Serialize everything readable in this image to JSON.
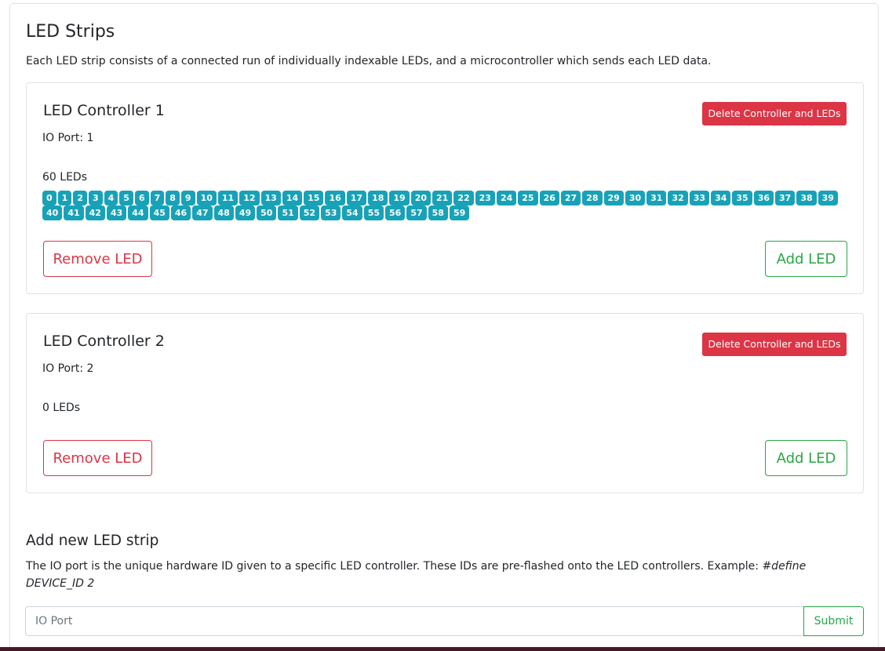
{
  "page": {
    "title": "LED Strips",
    "description": "Each LED strip consists of a connected run of individually indexable LEDs, and a microcontroller which sends each LED data."
  },
  "controllers": [
    {
      "title": "LED Controller 1",
      "io_port": "IO Port: 1",
      "led_count": "60 LEDs",
      "delete_label": "Delete Controller and LEDs",
      "remove_label": "Remove LED",
      "add_label": "Add LED",
      "leds": [
        "0",
        "1",
        "2",
        "3",
        "4",
        "5",
        "6",
        "7",
        "8",
        "9",
        "10",
        "11",
        "12",
        "13",
        "14",
        "15",
        "16",
        "17",
        "18",
        "19",
        "20",
        "21",
        "22",
        "23",
        "24",
        "25",
        "26",
        "27",
        "28",
        "29",
        "30",
        "31",
        "32",
        "33",
        "34",
        "35",
        "36",
        "37",
        "38",
        "39",
        "40",
        "41",
        "42",
        "43",
        "44",
        "45",
        "46",
        "47",
        "48",
        "49",
        "50",
        "51",
        "52",
        "53",
        "54",
        "55",
        "56",
        "57",
        "58",
        "59"
      ]
    },
    {
      "title": "LED Controller 2",
      "io_port": "IO Port: 2",
      "led_count": "0 LEDs",
      "delete_label": "Delete Controller and LEDs",
      "remove_label": "Remove LED",
      "add_label": "Add LED",
      "leds": []
    }
  ],
  "new_strip": {
    "title": "Add new LED strip",
    "description": "The IO port is the unique hardware ID given to a specific LED controller. These IDs are pre-flashed onto the LED controllers. Example: ",
    "example_code": "#define DEVICE_ID 2",
    "input_placeholder": "IO Port",
    "input_value": "",
    "submit_label": "Submit"
  },
  "colors": {
    "danger": "#dc3545",
    "success": "#28a745",
    "led_badge": "#17a2b8",
    "bottom_bar": "#4b1528"
  }
}
